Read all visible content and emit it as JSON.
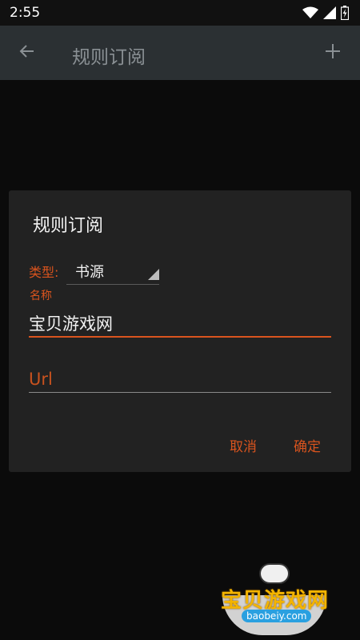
{
  "status_bar": {
    "time": "2:55",
    "icons": [
      "wifi-icon",
      "signal-icon",
      "battery-charging-icon"
    ]
  },
  "toolbar": {
    "title": "规则订阅",
    "back_icon": "arrow-left-icon",
    "add_icon": "plus-icon"
  },
  "dialog": {
    "title": "规则订阅",
    "type_label": "类型:",
    "type_value": "书源",
    "name_label": "名称",
    "name_value": "宝贝游戏网",
    "url_placeholder": "Url",
    "cancel_label": "取消",
    "confirm_label": "确定"
  },
  "watermark": {
    "text": "宝贝游戏网",
    "url": "baobeiy.com"
  },
  "colors": {
    "accent": "#d9541e",
    "toolbar": "#2b3033",
    "dialog": "#222222",
    "background": "#0b0b0b"
  }
}
